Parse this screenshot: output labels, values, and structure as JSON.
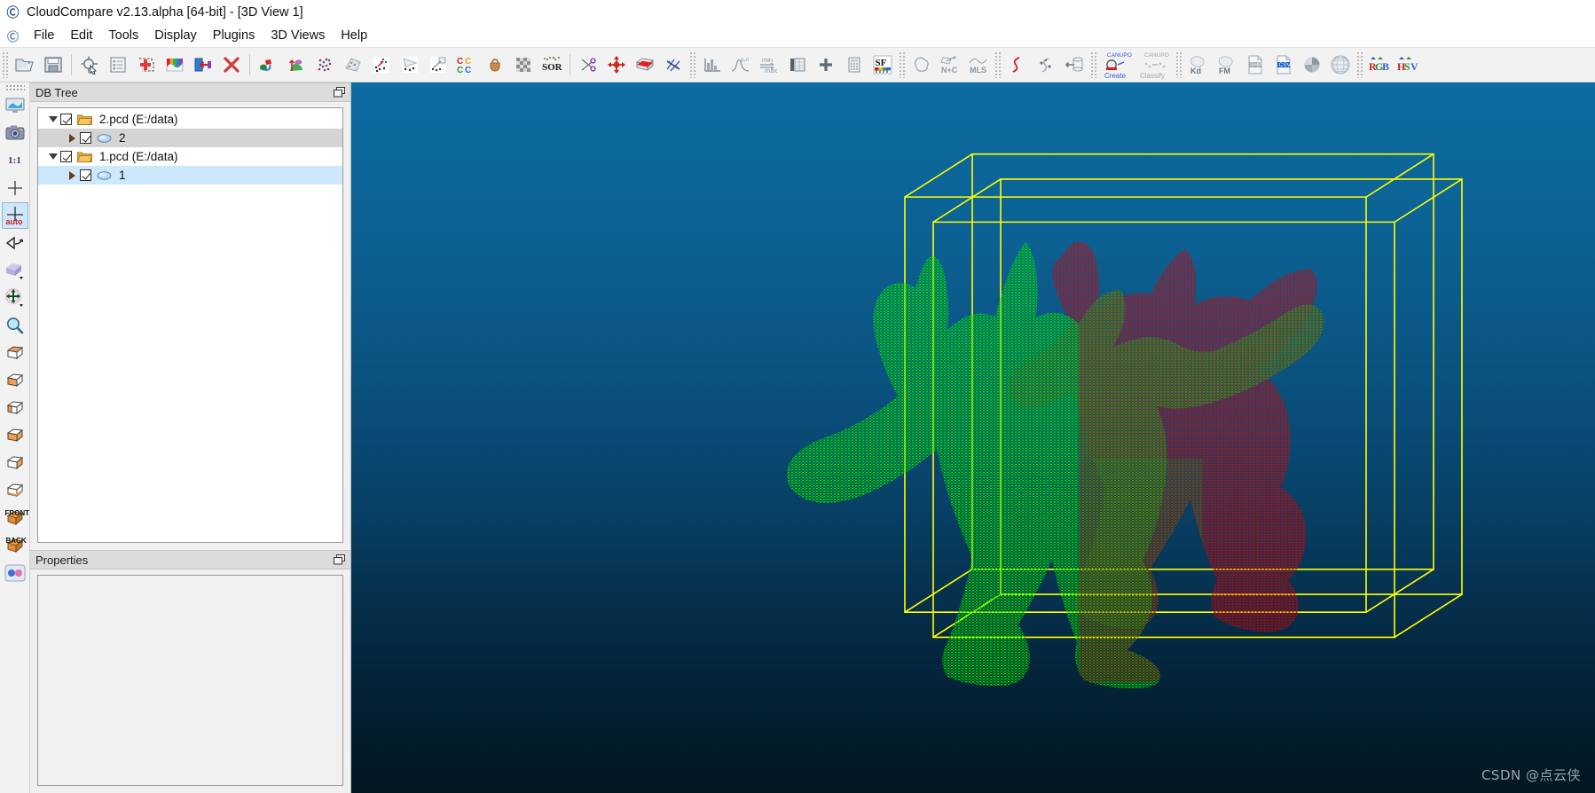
{
  "window": {
    "app_icon": "cloudcompare-logo-icon",
    "title": "CloudCompare v2.13.alpha [64-bit] - [3D View 1]"
  },
  "menu": {
    "icon": "cloudcompare-logo-icon",
    "items": [
      {
        "label": "File"
      },
      {
        "label": "Edit"
      },
      {
        "label": "Tools"
      },
      {
        "label": "Display"
      },
      {
        "label": "Plugins"
      },
      {
        "label": "3D Views"
      },
      {
        "label": "Help"
      }
    ]
  },
  "toolbar": {
    "groups": [
      {
        "items": [
          {
            "icon": "open-folder-icon",
            "label": "Open"
          },
          {
            "icon": "save-floppy-icon",
            "label": "Save"
          }
        ]
      },
      {
        "items": [
          {
            "icon": "pick-point-icon",
            "label": "Pick point"
          },
          {
            "icon": "properties-list-icon",
            "label": "Toggle properties"
          },
          {
            "icon": "add-point-icon",
            "label": "Segment"
          },
          {
            "icon": "rainbow-colors-icon",
            "label": "Colors"
          },
          {
            "icon": "export-icon",
            "label": "Export"
          },
          {
            "icon": "delete-cross-icon",
            "label": "Delete"
          }
        ]
      },
      {
        "items": [
          {
            "icon": "registration-icon",
            "label": "Register"
          },
          {
            "icon": "normals-icon",
            "label": "Compute normals"
          },
          {
            "icon": "scatter-points-icon",
            "label": "Sample points"
          },
          {
            "icon": "mesh-icon",
            "label": "Mesh"
          },
          {
            "icon": "cloud-to-cloud-icon",
            "label": "Cloud/cloud dist"
          },
          {
            "icon": "cloud-to-mesh-icon",
            "label": "Cloud/mesh dist"
          },
          {
            "icon": "cloud-primitive-icon",
            "label": "Cloud/primitive dist"
          },
          {
            "icon": "cc-compare-icon",
            "label": "CC compare"
          },
          {
            "icon": "bag-icon",
            "label": "Plugin"
          },
          {
            "icon": "checkerboard-icon",
            "label": "Subsample"
          },
          {
            "icon": "sor-filter-icon",
            "label": "SOR filter"
          }
        ]
      },
      {
        "items": [
          {
            "icon": "scissors-icon",
            "label": "Cut"
          },
          {
            "icon": "translate-rotate-icon",
            "label": "Translate/Rotate"
          },
          {
            "icon": "cross-section-icon",
            "label": "Cross section"
          },
          {
            "icon": "fit-plane-icon",
            "label": "Fit plane"
          }
        ]
      },
      {
        "items": [
          {
            "icon": "histogram-icon",
            "label": "Histogram"
          },
          {
            "icon": "gauss-stats-icon",
            "label": "Statistics"
          },
          {
            "icon": "min-max-icon",
            "label": "Min/Max"
          },
          {
            "icon": "table-icon",
            "label": "Table"
          },
          {
            "icon": "plus-icon",
            "label": "Add"
          },
          {
            "icon": "calculator-icon",
            "label": "Calculator"
          },
          {
            "icon": "scalar-field-icon",
            "label": "SF"
          }
        ]
      },
      {
        "items": [
          {
            "icon": "label-connected-icon",
            "label": "Label connected comp."
          },
          {
            "icon": "normals-convert-icon",
            "label": "N+C"
          },
          {
            "icon": "mls-icon",
            "label": "MLS"
          }
        ]
      },
      {
        "items": [
          {
            "icon": "curve-fit-icon",
            "label": "Curvature"
          },
          {
            "icon": "point-pairs-icon",
            "label": "Point pairs"
          },
          {
            "icon": "unroll-icon",
            "label": "Unroll"
          }
        ]
      },
      {
        "items": [
          {
            "icon": "canupo-create-icon",
            "label": "CANUPO Create"
          },
          {
            "icon": "canupo-classify-icon",
            "label": "CANUPO Classify"
          }
        ]
      },
      {
        "items": [
          {
            "icon": "kd-tree-icon",
            "label": "Kd"
          },
          {
            "icon": "fm-icon",
            "label": "FM"
          },
          {
            "icon": "shp-file-icon",
            "label": "SHP"
          },
          {
            "icon": "csv-file-icon",
            "label": "CSV"
          },
          {
            "icon": "pie-icon",
            "label": "Pie"
          },
          {
            "icon": "globe-icon",
            "label": "Globe"
          }
        ]
      },
      {
        "items": [
          {
            "icon": "rgb-convert-icon",
            "label": "RGB"
          },
          {
            "icon": "hsv-convert-icon",
            "label": "HSV"
          }
        ]
      }
    ]
  },
  "view_toolbar": {
    "items": [
      {
        "icon": "display-monitor-icon",
        "label": "Display settings",
        "active": false
      },
      {
        "icon": "camera-snapshot-icon",
        "label": "Snapshot",
        "active": false
      },
      {
        "icon": "zoom-one-to-one-icon",
        "label": "1:1",
        "text": "1:1",
        "active": false
      },
      {
        "icon": "crosshair-center-icon",
        "label": "Set pivot",
        "active": false
      },
      {
        "icon": "crosshair-auto-icon",
        "label": "auto",
        "text": "auto",
        "active": true
      },
      {
        "icon": "rotate-view-icon",
        "label": "Rotate view",
        "active": false
      },
      {
        "icon": "cube-dropdown-icon",
        "label": "Default views",
        "active": false
      },
      {
        "icon": "move-pivot-icon",
        "label": "Pivot mode",
        "active": false
      },
      {
        "icon": "magnifier-icon",
        "label": "Zoom",
        "active": false
      },
      {
        "icon": "view-top-icon",
        "label": "Top view",
        "active": false
      },
      {
        "icon": "view-bottom-icon",
        "label": "Bottom view",
        "active": false
      },
      {
        "icon": "view-left-icon",
        "label": "Left view",
        "active": false
      },
      {
        "icon": "view-right-icon",
        "label": "Right view",
        "active": false
      },
      {
        "icon": "view-iso1-icon",
        "label": "Iso view 1",
        "active": false
      },
      {
        "icon": "view-iso2-icon",
        "label": "Iso view 2",
        "active": false
      },
      {
        "icon": "view-front-icon",
        "label": "FRONT",
        "text": "FRONT",
        "active": false
      },
      {
        "icon": "view-back-icon",
        "label": "BACK",
        "text": "BACK",
        "active": false
      },
      {
        "icon": "two-color-dots-icon",
        "label": "Stereo mode",
        "active": false
      }
    ]
  },
  "db_tree": {
    "title": "DB Tree",
    "float_icon": "float-panel-icon",
    "rows": [
      {
        "label": "2.pcd (E:/data)",
        "icon": "folder-icon",
        "expander": "down",
        "checked": true,
        "depth": 0,
        "state": "normal"
      },
      {
        "label": "2",
        "icon": "point-cloud-icon",
        "expander": "right",
        "checked": true,
        "depth": 1,
        "state": "gray"
      },
      {
        "label": "1.pcd (E:/data)",
        "icon": "folder-icon",
        "expander": "down",
        "checked": true,
        "depth": 0,
        "state": "normal"
      },
      {
        "label": "1",
        "icon": "point-cloud-icon",
        "expander": "right",
        "checked": true,
        "depth": 1,
        "state": "selected"
      }
    ]
  },
  "properties": {
    "title": "Properties",
    "float_icon": "float-panel-icon",
    "content": ""
  },
  "view3d": {
    "watermark": "CSDN @点云侠",
    "background_top_color": "#0d6ca1",
    "background_bottom_color": "#021620",
    "bbox_color": "#ffff00",
    "cloud_colors": [
      {
        "name": "1",
        "color": "#00e000"
      },
      {
        "name": "2",
        "color": "#e00000"
      }
    ]
  }
}
